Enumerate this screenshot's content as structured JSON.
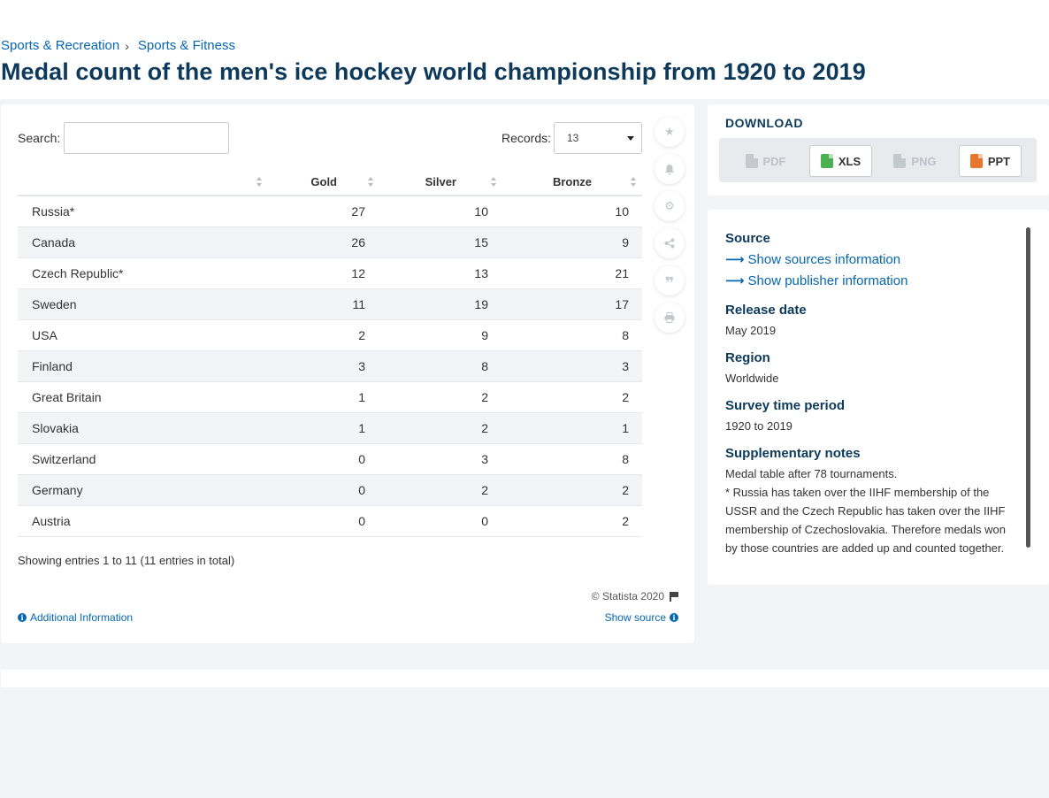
{
  "breadcrumb": {
    "items": [
      "Sports & Recreation",
      "Sports & Fitness"
    ],
    "separator": "›"
  },
  "title": "Medal count of the men's ice hockey world championship from 1920 to 2019",
  "table_controls": {
    "search_label": "Search:",
    "search_value": "",
    "records_label": "Records:",
    "records_value": "13"
  },
  "table": {
    "columns": [
      "",
      "Gold",
      "Silver",
      "Bronze"
    ],
    "rows": [
      {
        "country": "Russia*",
        "gold": "27",
        "silver": "10",
        "bronze": "10"
      },
      {
        "country": "Canada",
        "gold": "26",
        "silver": "15",
        "bronze": "9"
      },
      {
        "country": "Czech Republic*",
        "gold": "12",
        "silver": "13",
        "bronze": "21"
      },
      {
        "country": "Sweden",
        "gold": "11",
        "silver": "19",
        "bronze": "17"
      },
      {
        "country": "USA",
        "gold": "2",
        "silver": "9",
        "bronze": "8"
      },
      {
        "country": "Finland",
        "gold": "3",
        "silver": "8",
        "bronze": "3"
      },
      {
        "country": "Great Britain",
        "gold": "1",
        "silver": "2",
        "bronze": "2"
      },
      {
        "country": "Slovakia",
        "gold": "1",
        "silver": "2",
        "bronze": "1"
      },
      {
        "country": "Switzerland",
        "gold": "0",
        "silver": "3",
        "bronze": "8"
      },
      {
        "country": "Germany",
        "gold": "0",
        "silver": "2",
        "bronze": "2"
      },
      {
        "country": "Austria",
        "gold": "0",
        "silver": "0",
        "bronze": "2"
      }
    ]
  },
  "entries_info": "Showing entries 1 to 11 (11 entries in total)",
  "footer": {
    "copyright": "© Statista 2020",
    "additional_info": "Additional Information",
    "show_source": "Show source"
  },
  "toolbar": {
    "icons": [
      "star-icon",
      "bell-icon",
      "gear-icon",
      "share-icon",
      "quote-icon",
      "print-icon"
    ]
  },
  "download": {
    "title": "DOWNLOAD",
    "buttons": [
      {
        "label": "PDF",
        "enabled": false,
        "color": "#c4c9ce"
      },
      {
        "label": "XLS",
        "enabled": true,
        "color": "#4caf50"
      },
      {
        "label": "PNG",
        "enabled": false,
        "color": "#c4c9ce"
      },
      {
        "label": "PPT",
        "enabled": true,
        "color": "#e8772e"
      }
    ]
  },
  "meta": {
    "source_heading": "Source",
    "show_sources": "Show sources information",
    "show_publisher": "Show publisher information",
    "release_heading": "Release date",
    "release_value": "May 2019",
    "region_heading": "Region",
    "region_value": "Worldwide",
    "period_heading": "Survey time period",
    "period_value": "1920 to 2019",
    "notes_heading": "Supplementary notes",
    "notes_line1": "Medal table after 78 tournaments.",
    "notes_line2": "* Russia has taken over the IIHF membership of the USSR and the Czech Republic has taken over the IIHF membership of Czechoslovakia. Therefore medals won by those countries are added up and counted together."
  },
  "colors": {
    "link": "#0666b0",
    "title": "#0d3a5b",
    "background": "#f2f4f6"
  }
}
